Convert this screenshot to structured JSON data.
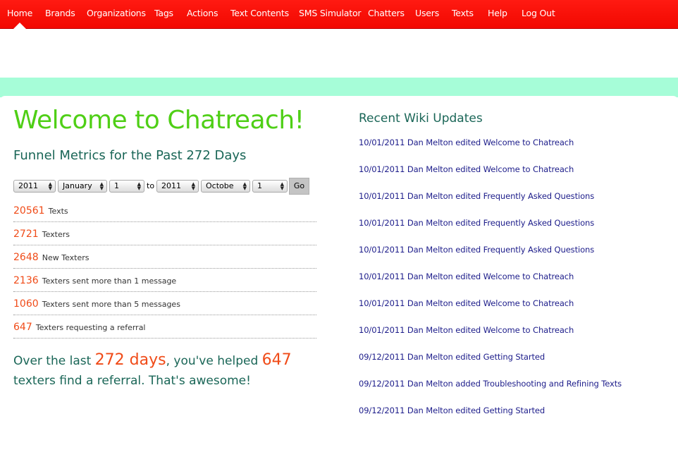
{
  "nav": {
    "items": [
      "Home",
      "Brands",
      "Organizations",
      "Tags",
      "Actions",
      "Text Contents",
      "SMS Simulator",
      "Chatters",
      "Users",
      "Texts",
      "Help",
      "Log Out"
    ],
    "active": "Home"
  },
  "colors": {
    "nav_background": "#f71005",
    "mint_band": "#a6fdd8",
    "title_green": "#4fcf16",
    "heading_teal": "#1a6657",
    "number_orange": "#f04b18",
    "wiki_link": "#1c1c8a"
  },
  "main": {
    "title": "Welcome to Chatreach!",
    "funnel_heading": "Funnel Metrics for the Past 272 Days",
    "filters": {
      "start_year": "2011",
      "start_month": "January",
      "start_day": "1",
      "to_label": "to",
      "end_year": "2011",
      "end_month": "Octobe",
      "end_day": "1",
      "go_label": "Go"
    },
    "metrics": [
      {
        "value": "20561",
        "label": "Texts"
      },
      {
        "value": "2721",
        "label": "Texters"
      },
      {
        "value": "2648",
        "label": "New Texters"
      },
      {
        "value": "2136",
        "label": "Texters sent more than 1 message"
      },
      {
        "value": "1060",
        "label": "Texters sent more than 5 messages"
      },
      {
        "value": "647",
        "label": "Texters requesting a referral"
      }
    ],
    "summary": {
      "part1": "Over the last ",
      "days": "272 days",
      "part2": ", you've helped ",
      "count": "647",
      "part3": " texters find a referral. That's awesome!"
    }
  },
  "wiki": {
    "heading": "Recent Wiki Updates",
    "items": [
      "10/01/2011 Dan Melton edited Welcome to Chatreach",
      "10/01/2011 Dan Melton edited Welcome to Chatreach",
      "10/01/2011 Dan Melton edited Frequently Asked Questions",
      "10/01/2011 Dan Melton edited Frequently Asked Questions",
      "10/01/2011 Dan Melton edited Frequently Asked Questions",
      "10/01/2011 Dan Melton edited Welcome to Chatreach",
      "10/01/2011 Dan Melton edited Welcome to Chatreach",
      "10/01/2011 Dan Melton edited Welcome to Chatreach",
      "09/12/2011 Dan Melton edited Getting Started",
      "09/12/2011 Dan Melton added Troubleshooting and Refining Texts",
      "09/12/2011 Dan Melton edited Getting Started"
    ]
  }
}
